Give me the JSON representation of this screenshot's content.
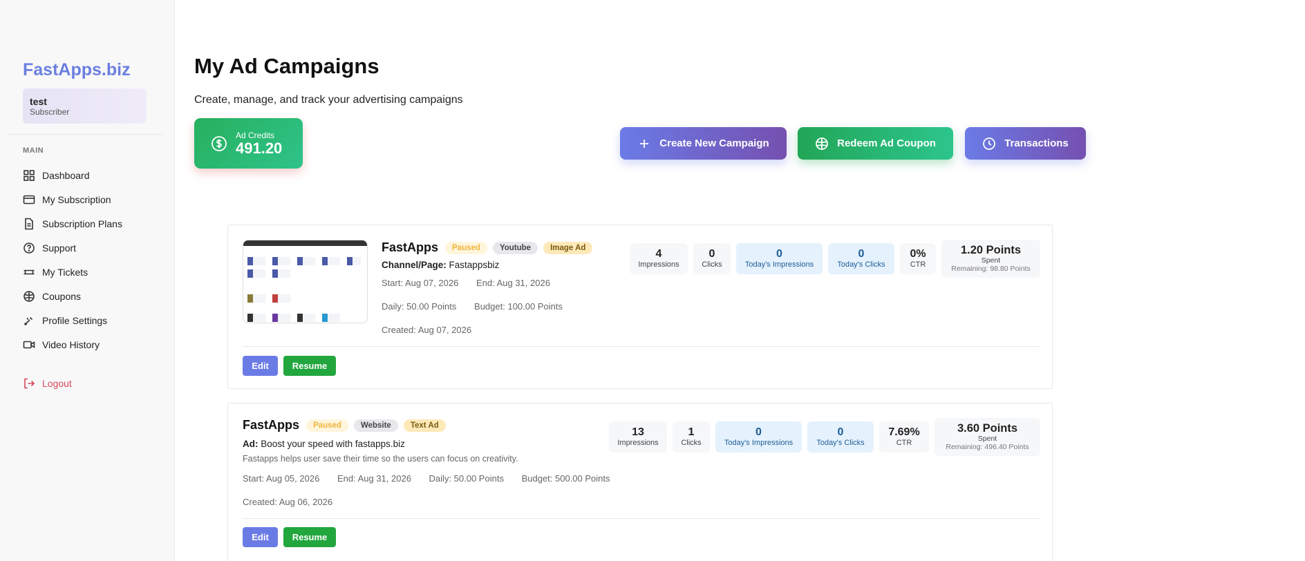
{
  "sidebar": {
    "brand": "FastApps.biz",
    "user": {
      "name": "test",
      "role": "Subscriber"
    },
    "section_label": "MAIN",
    "items": [
      {
        "label": "Dashboard",
        "icon": "grid-icon"
      },
      {
        "label": "My Subscription",
        "icon": "credit-card-icon"
      },
      {
        "label": "Subscription Plans",
        "icon": "document-icon"
      },
      {
        "label": "Support",
        "icon": "help-circle-icon"
      },
      {
        "label": "My Tickets",
        "icon": "ticket-icon"
      },
      {
        "label": "Coupons",
        "icon": "coupon-icon"
      },
      {
        "label": "Profile Settings",
        "icon": "tools-icon"
      },
      {
        "label": "Video History",
        "icon": "video-icon"
      }
    ],
    "logout": "Logout"
  },
  "header": {
    "title": "My Ad Campaigns",
    "subtitle": "Create, manage, and track your advertising campaigns"
  },
  "credits": {
    "label": "Ad Credits",
    "value": "491.20"
  },
  "actions": {
    "create": "Create New Campaign",
    "redeem": "Redeem Ad Coupon",
    "transactions": "Transactions"
  },
  "campaigns": [
    {
      "title": "FastApps",
      "status": "Paused",
      "platform": "Youtube",
      "ad_type": "Image Ad",
      "channel_label": "Channel/Page:",
      "channel_value": "Fastappsbiz",
      "start": "Start: Aug 07, 2026",
      "end": "End: Aug 31, 2026",
      "daily": "Daily: 50.00 Points",
      "budget": "Budget: 100.00 Points",
      "created": "Created: Aug 07, 2026",
      "stats": {
        "impressions": "4",
        "impressions_label": "Impressions",
        "clicks": "0",
        "clicks_label": "Clicks",
        "today_impressions": "0",
        "today_impressions_label": "Today's Impressions",
        "today_clicks": "0",
        "today_clicks_label": "Today's Clicks",
        "ctr": "0%",
        "ctr_label": "CTR",
        "spent": "1.20 Points",
        "spent_label": "Spent",
        "remaining": "Remaining: 98.80 Points"
      },
      "edit": "Edit",
      "resume": "Resume"
    },
    {
      "title": "FastApps",
      "status": "Paused",
      "platform": "Website",
      "ad_type": "Text Ad",
      "ad_label": "Ad:",
      "ad_value": "Boost your speed with fastapps.biz",
      "description": "Fastapps helps user save their time so the users can focus on creativity.",
      "start": "Start: Aug 05, 2026",
      "end": "End: Aug 31, 2026",
      "daily": "Daily: 50.00 Points",
      "budget": "Budget: 500.00 Points",
      "created": "Created: Aug 06, 2026",
      "stats": {
        "impressions": "13",
        "impressions_label": "Impressions",
        "clicks": "1",
        "clicks_label": "Clicks",
        "today_impressions": "0",
        "today_impressions_label": "Today's Impressions",
        "today_clicks": "0",
        "today_clicks_label": "Today's Clicks",
        "ctr": "7.69%",
        "ctr_label": "CTR",
        "spent": "3.60 Points",
        "spent_label": "Spent",
        "remaining": "Remaining: 496.40 Points"
      },
      "edit": "Edit",
      "resume": "Resume"
    }
  ],
  "colors": {
    "brand": "#6b7fe0",
    "green": "#22a657",
    "purple": "#7550b0",
    "paused": "#f0b43c",
    "logout": "#d9485a"
  }
}
